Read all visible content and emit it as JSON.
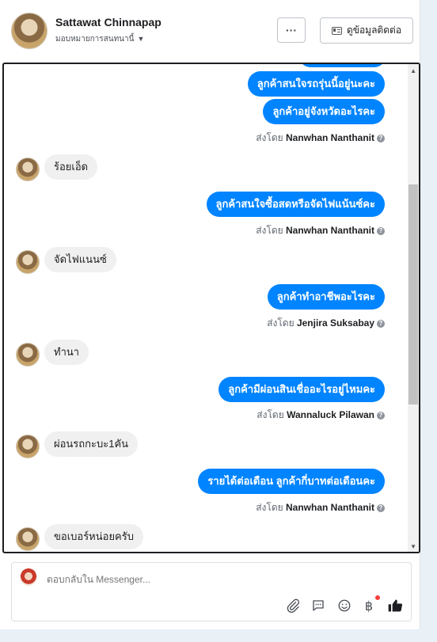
{
  "header": {
    "name": "Sattawat Chinnapap",
    "subtitle": "มอบหมายการสนทนานี้",
    "more_label": "···",
    "info_label": "ดูข้อมูลติดต่อ"
  },
  "conversation": {
    "sent_prefix": "ส่งโดย",
    "messages": [
      {
        "type": "out",
        "text": "ลูกค้าสนใจรถรุ่นนี้อยู่นะคะ"
      },
      {
        "type": "out",
        "text": "ลูกค้าอยู่จังหวัดอะไรคะ"
      },
      {
        "type": "sent",
        "by": "Nanwhan Nanthanit"
      },
      {
        "type": "in",
        "text": "ร้อยเอ็ด"
      },
      {
        "type": "out",
        "text": "ลูกค้าสนใจซื้อสดหรือจัดไฟแน้นซ์คะ"
      },
      {
        "type": "sent",
        "by": "Nanwhan Nanthanit"
      },
      {
        "type": "in",
        "text": "จัดไฟแนนซ์"
      },
      {
        "type": "out",
        "text": "ลูกค้าทำอาชีพอะไรคะ"
      },
      {
        "type": "sent",
        "by": "Jenjira Suksabay"
      },
      {
        "type": "in",
        "text": "ทำนา"
      },
      {
        "type": "out",
        "text": "ลูกค้ามีผ่อนสินเชื่ออะไรอยู่ไหมคะ"
      },
      {
        "type": "sent",
        "by": "Wannaluck Pilawan"
      },
      {
        "type": "in",
        "text": "ผ่อนรถกะบะ1คัน"
      },
      {
        "type": "out",
        "text": "รายได้ต่อเดือน ลูกค้ากี่บาทต่อเดือนคะ"
      },
      {
        "type": "sent",
        "by": "Nanwhan Nanthanit"
      },
      {
        "type": "in",
        "text": "ขอเบอร์หน่อยครับ"
      }
    ]
  },
  "composer": {
    "placeholder": "ตอบกลับใน Messenger..."
  },
  "colors": {
    "accent": "#0084ff",
    "incoming_bubble": "#f1f0f0",
    "notification_dot": "#fa3e3e"
  },
  "icons": [
    "attachment-icon",
    "saved-reply-icon",
    "emoji-icon",
    "payment-icon",
    "like-icon"
  ]
}
